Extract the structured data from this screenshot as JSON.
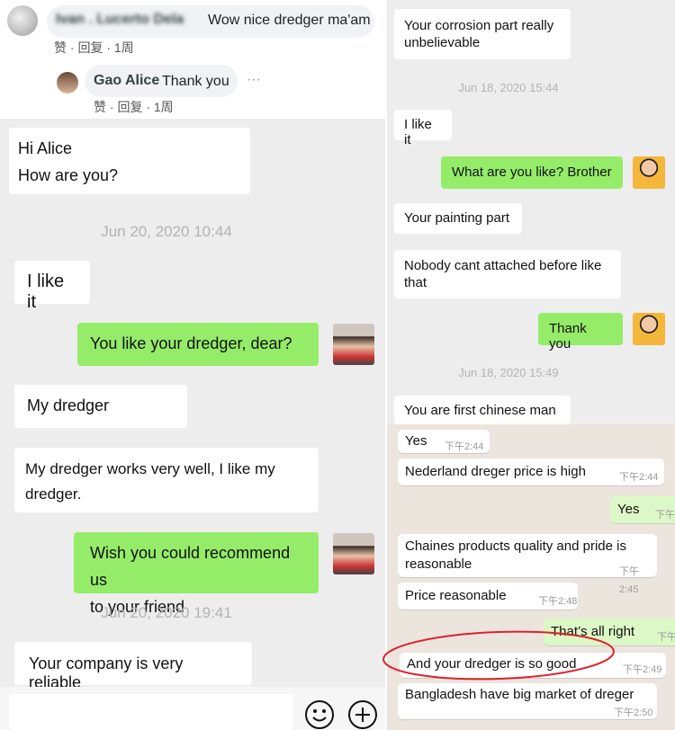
{
  "left": {
    "comment_top": {
      "author": "Ivan . Lucerto Dela",
      "text": "Wow nice dredger ma'am",
      "actions": "赞 · 回复 · 1周"
    },
    "comment_reply": {
      "author": "Gao Alice",
      "text": "Thank you",
      "more": "···",
      "actions": "赞 · 回复 · 1周"
    },
    "messages": [
      {
        "side": "left",
        "line1": "Hi Alice",
        "line2": "How are you?"
      },
      {
        "side": "time",
        "text": "Jun 20, 2020 10:44"
      },
      {
        "side": "left",
        "text": "I like it"
      },
      {
        "side": "right",
        "text": "You like your dredger, dear?"
      },
      {
        "side": "left",
        "text": "My dredger"
      },
      {
        "side": "left",
        "line1": "My dredger works very well, I like my",
        "line2": "dredger."
      },
      {
        "side": "right",
        "line1": "Wish you could recommend us",
        "line2": "to your friend"
      },
      {
        "side": "time",
        "text": "Jun 20, 2020 19:41"
      },
      {
        "side": "left",
        "text": "Your company is very reliable"
      }
    ],
    "input_bar": {
      "emoji_icon": "smiley-icon",
      "add_icon": "plus-circle-icon"
    }
  },
  "right": {
    "messages": [
      {
        "side": "left",
        "line1": "Your corrosion part really",
        "line2": "unbelievable"
      },
      {
        "side": "time",
        "text": "Jun 18, 2020 15:44"
      },
      {
        "side": "left",
        "text": "I like it"
      },
      {
        "side": "right",
        "text": "What are you like? Brother"
      },
      {
        "side": "left",
        "text": "Your painting part"
      },
      {
        "side": "left",
        "line1": "Nobody cant attached before like",
        "line2": "that"
      },
      {
        "side": "right",
        "text": "Thank you"
      },
      {
        "side": "time",
        "text": "Jun 18, 2020 15:49"
      },
      {
        "side": "left",
        "text": "You are first chinese man"
      }
    ],
    "whatsapp": [
      {
        "text": "Yes",
        "time": "下午2:44"
      },
      {
        "text": "Nederland dreger price is high",
        "time": "下午2:44"
      },
      {
        "text": "Yes",
        "time": "下午"
      },
      {
        "line1": "Chaines products quality and pride is",
        "line2": "reasonable",
        "time": "下午2:45"
      },
      {
        "text": "Price reasonable",
        "time": "下午2:48"
      },
      {
        "text": "That’s all right",
        "time": "下午"
      },
      {
        "text": "And your dredger is so good",
        "time": "下午2:49"
      },
      {
        "text": "Bangladesh have big market of dreger",
        "time": "下午2:50"
      }
    ]
  },
  "colors": {
    "wechat_green": "#95ec69",
    "whatsapp_green": "#dcf8c6",
    "highlight_circle": "#e0202a",
    "chat_bg": "#ededed"
  }
}
